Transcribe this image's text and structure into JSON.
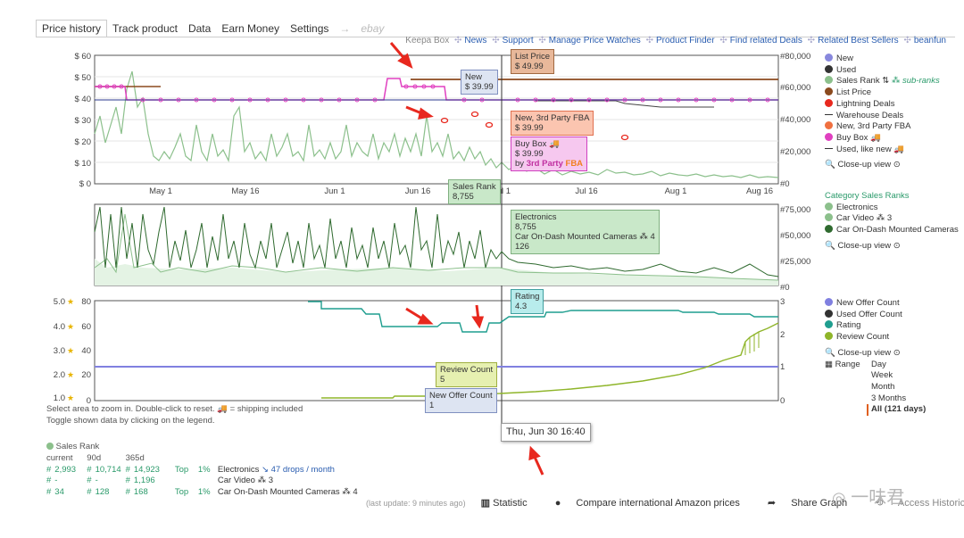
{
  "tabs": [
    "Price history",
    "Track product",
    "Data",
    "Earn Money",
    "Settings"
  ],
  "tab_arrow": "→",
  "tab_ebay": "ebay",
  "toplinks": {
    "keepa_box": "Keepa Box",
    "items": [
      "News",
      "Support",
      "Manage Price Watches",
      "Product Finder",
      "Find related Deals",
      "Related Best Sellers",
      "beanfun"
    ]
  },
  "chart_data": [
    {
      "type": "line",
      "title": "",
      "y_left_ticks": [
        "$ 60",
        "$ 50",
        "$ 40",
        "$ 30",
        "$ 20",
        "$ 10",
        "$ 0"
      ],
      "y_right_ticks": [
        "#80,000",
        "#60,000",
        "#40,000",
        "#20,000",
        "#0"
      ],
      "x_ticks": [
        "May 1",
        "May 16",
        "Jun 1",
        "Jun 16",
        "Jul 1",
        "Jul 16",
        "Aug 1",
        "Aug 16"
      ],
      "series": [
        {
          "name": "List Price",
          "values": [
            49.99,
            49.99
          ]
        },
        {
          "name": "New",
          "values": [
            48,
            48,
            41,
            41,
            41,
            41,
            50,
            48,
            41,
            41,
            41
          ]
        },
        {
          "name": "Buy Box",
          "values": [
            48,
            48,
            41,
            41,
            41,
            41,
            50,
            48,
            41,
            41,
            41
          ]
        },
        {
          "name": "Sales Rank",
          "values": [
            30000,
            62000,
            18000,
            28000,
            22000,
            26000,
            14000,
            16000,
            8755,
            6000,
            4000,
            3000
          ]
        }
      ]
    },
    {
      "type": "area",
      "title": "Category Sales Ranks",
      "y_right_ticks": [
        "#75,000",
        "#50,000",
        "#25,000",
        "#0"
      ]
    },
    {
      "type": "line",
      "y_left_ticks": [
        "5.0",
        "4.0",
        "3.0",
        "2.0",
        "1.0"
      ],
      "y_mid_ticks": [
        "80",
        "60",
        "40",
        "20",
        "0"
      ],
      "y_right_ticks": [
        "3",
        "2",
        "1",
        "0"
      ],
      "series": [
        {
          "name": "Rating",
          "values": [
            4.6,
            4.6,
            4.4,
            4.0,
            4.0,
            3.9,
            4.2,
            4.3,
            4.4,
            4.4,
            4.3
          ]
        },
        {
          "name": "Review Count",
          "values": [
            0,
            0,
            1,
            2,
            5,
            10,
            20,
            35,
            50,
            70
          ]
        },
        {
          "name": "New Offer Count",
          "values": [
            1,
            1
          ]
        }
      ]
    }
  ],
  "tooltips": {
    "list_price": {
      "title": "List Price",
      "value": "$ 49.99"
    },
    "new": {
      "title": "New",
      "value": "$ 39.99"
    },
    "new3p": {
      "title": "New, 3rd Party FBA",
      "value": "$ 39.99"
    },
    "buybox": {
      "title": "Buy Box",
      "value": "$ 39.99",
      "by": "by",
      "seller": "3rd Party",
      "fba": "FBA"
    },
    "salesrank": {
      "title": "Sales Rank",
      "value": "8,755"
    },
    "electronics": {
      "title": "Electronics",
      "value": "8,755",
      "sub": "Car On-Dash Mounted Cameras",
      "sub_num": "4",
      "sub_value": "126"
    },
    "rating": {
      "title": "Rating",
      "value": "4.3"
    },
    "reviews": {
      "title": "Review Count",
      "value": "5"
    },
    "offers": {
      "title": "New Offer Count",
      "value": "1"
    },
    "date": "Thu, Jun 30 16:40"
  },
  "legend_main": [
    "New",
    "Used",
    "Sales Rank",
    "List Price",
    "Lightning Deals",
    "Warehouse Deals",
    "New, 3rd Party FBA",
    "Buy Box",
    "Used, like new"
  ],
  "legend_subranks": "sub-ranks",
  "closeup": "Close-up view",
  "legend_cat_title": "Category Sales Ranks",
  "legend_cat": [
    "Electronics",
    "Car Video",
    "Car On-Dash Mounted Cameras"
  ],
  "legend_cat_num": "3",
  "legend_bottom": [
    "New Offer Count",
    "Used Offer Count",
    "Rating",
    "Review Count"
  ],
  "range_label": "Range",
  "ranges": [
    "Day",
    "Week",
    "Month",
    "3 Months",
    "All (121 days)"
  ],
  "hints": {
    "line1_a": "Select area to zoom in. Double-click to reset.",
    "line1_b": "= shipping included",
    "line2": "Toggle shown data by clicking on the legend."
  },
  "stats": {
    "title": "Sales Rank",
    "headers": [
      "current",
      "90d",
      "365d"
    ],
    "rows": [
      {
        "c": "2,993",
        "d90": "10,714",
        "d365": "14,923",
        "top": "Top",
        "pct": "1%",
        "cat": "Electronics",
        "extra": "47 drops / month"
      },
      {
        "c": "-",
        "d90": "-",
        "d365": "1,196",
        "top": "",
        "pct": "",
        "cat": "Car Video",
        "extra": "3"
      },
      {
        "c": "34",
        "d90": "128",
        "d365": "168",
        "top": "Top",
        "pct": "1%",
        "cat": "Car On-Dash Mounted Cameras",
        "extra": "4"
      }
    ]
  },
  "footer": {
    "last_update": "(last update: 9 minutes ago)",
    "statistic": "Statistic",
    "compare": "Compare international Amazon prices",
    "share": "Share Graph",
    "historical": "Access Historical Data"
  },
  "watermark": "一味君",
  "colors": {
    "sales_rank": "#8cc08c",
    "new": "#2b3a8f",
    "buybox": "#e040c0",
    "list_price": "#8b4a1e",
    "rating": "#1f9e8f",
    "review": "#8fb52a",
    "offer": "#8080e0",
    "arrow": "#e8281e"
  }
}
